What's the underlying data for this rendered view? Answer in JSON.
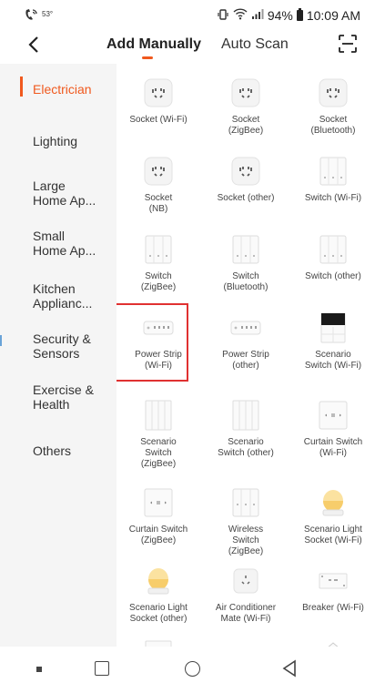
{
  "status": {
    "temp": "53°",
    "battery": "94%",
    "time": "10:09 AM"
  },
  "header": {
    "tabs": [
      "Add Manually",
      "Auto Scan"
    ]
  },
  "accent": "#f0591e",
  "sidebar": {
    "items": [
      {
        "label": "Electrician",
        "active": true
      },
      {
        "label": "Lighting",
        "active": false
      },
      {
        "label": "Large\nHome Ap...",
        "active": false
      },
      {
        "label": "Small\nHome Ap...",
        "active": false
      },
      {
        "label": "Kitchen\nApplianc...",
        "active": false
      },
      {
        "label": "Security &\nSensors",
        "active": false
      },
      {
        "label": "Exercise &\nHealth",
        "active": false
      },
      {
        "label": "Others",
        "active": false
      }
    ]
  },
  "devices": [
    {
      "label": "Socket (Wi-Fi)",
      "icon": "socket-icon"
    },
    {
      "label": "Socket\n(ZigBee)",
      "icon": "socket-icon"
    },
    {
      "label": "Socket\n(Bluetooth)",
      "icon": "socket-icon"
    },
    {
      "label": "Socket\n(NB)",
      "icon": "socket-icon"
    },
    {
      "label": "Socket (other)",
      "icon": "socket-icon"
    },
    {
      "label": "Switch (Wi-Fi)",
      "icon": "switch-icon"
    },
    {
      "label": "Switch\n(ZigBee)",
      "icon": "switch-icon"
    },
    {
      "label": "Switch\n(Bluetooth)",
      "icon": "switch-icon"
    },
    {
      "label": "Switch (other)",
      "icon": "switch-icon"
    },
    {
      "label": "Power Strip\n(Wi-Fi)",
      "icon": "power-strip-icon"
    },
    {
      "label": "Power Strip\n(other)",
      "icon": "power-strip-icon"
    },
    {
      "label": "Scenario\nSwitch (Wi-Fi)",
      "icon": "scenario-switch-icon"
    },
    {
      "label": "Scenario\nSwitch\n(ZigBee)",
      "icon": "scenario-panel-icon"
    },
    {
      "label": "Scenario\nSwitch (other)",
      "icon": "scenario-panel-icon"
    },
    {
      "label": "Curtain Switch\n(Wi-Fi)",
      "icon": "curtain-switch-icon"
    },
    {
      "label": "Curtain Switch\n(ZigBee)",
      "icon": "curtain-switch-icon"
    },
    {
      "label": "Wireless\nSwitch\n(ZigBee)",
      "icon": "wireless-switch-icon"
    },
    {
      "label": "Scenario Light\nSocket (Wi-Fi)",
      "icon": "light-socket-icon"
    },
    {
      "label": "Scenario Light\nSocket (other)",
      "icon": "light-socket-icon"
    },
    {
      "label": "Air Conditioner\nMate (Wi-Fi)",
      "icon": "ac-mate-icon"
    },
    {
      "label": "Breaker (Wi-Fi)",
      "icon": "breaker-icon"
    }
  ]
}
